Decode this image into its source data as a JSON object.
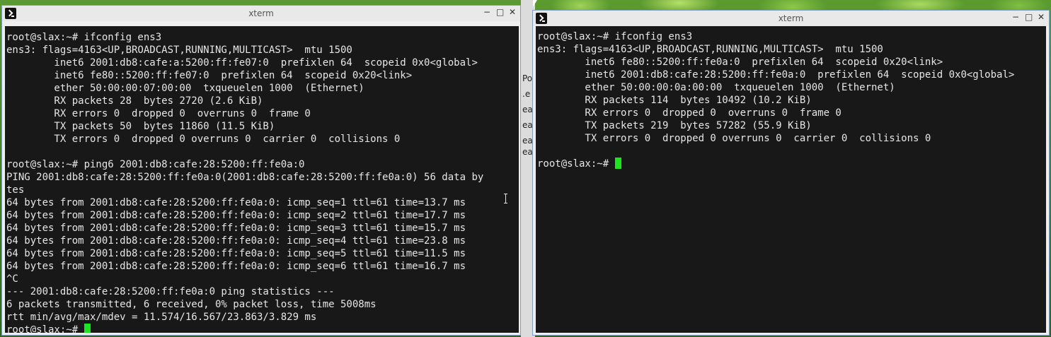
{
  "left_window": {
    "title": "xterm",
    "buttons": {
      "minimize": "−",
      "maximize": "□",
      "close": "✕"
    },
    "lines": [
      "root@slax:~# ifconfig ens3",
      "ens3: flags=4163<UP,BROADCAST,RUNNING,MULTICAST>  mtu 1500",
      "        inet6 2001:db8:cafe:a:5200:ff:fe07:0  prefixlen 64  scopeid 0x0<global>",
      "        inet6 fe80::5200:ff:fe07:0  prefixlen 64  scopeid 0x20<link>",
      "        ether 50:00:00:07:00:00  txqueuelen 1000  (Ethernet)",
      "        RX packets 28  bytes 2720 (2.6 KiB)",
      "        RX errors 0  dropped 0  overruns 0  frame 0",
      "        TX packets 50  bytes 11860 (11.5 KiB)",
      "        TX errors 0  dropped 0 overruns 0  carrier 0  collisions 0",
      "",
      "root@slax:~# ping6 2001:db8:cafe:28:5200:ff:fe0a:0",
      "PING 2001:db8:cafe:28:5200:ff:fe0a:0(2001:db8:cafe:28:5200:ff:fe0a:0) 56 data by",
      "tes",
      "64 bytes from 2001:db8:cafe:28:5200:ff:fe0a:0: icmp_seq=1 ttl=61 time=13.7 ms",
      "64 bytes from 2001:db8:cafe:28:5200:ff:fe0a:0: icmp_seq=2 ttl=61 time=17.7 ms",
      "64 bytes from 2001:db8:cafe:28:5200:ff:fe0a:0: icmp_seq=3 ttl=61 time=15.7 ms",
      "64 bytes from 2001:db8:cafe:28:5200:ff:fe0a:0: icmp_seq=4 ttl=61 time=23.8 ms",
      "64 bytes from 2001:db8:cafe:28:5200:ff:fe0a:0: icmp_seq=5 ttl=61 time=11.5 ms",
      "64 bytes from 2001:db8:cafe:28:5200:ff:fe0a:0: icmp_seq=6 ttl=61 time=16.7 ms",
      "^C",
      "--- 2001:db8:cafe:28:5200:ff:fe0a:0 ping statistics ---",
      "6 packets transmitted, 6 received, 0% packet loss, time 5008ms",
      "rtt min/avg/max/mdev = 11.574/16.567/23.863/3.829 ms"
    ],
    "prompt": "root@slax:~# "
  },
  "right_window": {
    "title": "xterm",
    "buttons": {
      "minimize": "−",
      "maximize": "□",
      "close": "✕"
    },
    "lines": [
      "root@slax:~# ifconfig ens3",
      "ens3: flags=4163<UP,BROADCAST,RUNNING,MULTICAST>  mtu 1500",
      "        inet6 fe80::5200:ff:fe0a:0  prefixlen 64  scopeid 0x20<link>",
      "        inet6 2001:db8:cafe:28:5200:ff:fe0a:0  prefixlen 64  scopeid 0x0<global>",
      "        ether 50:00:00:0a:00:00  txqueuelen 1000  (Ethernet)",
      "        RX packets 114  bytes 10492 (10.2 KiB)",
      "        RX errors 0  dropped 0  overruns 0  frame 0",
      "        TX packets 219  bytes 57282 (55.9 KiB)",
      "        TX errors 0  dropped 0 overruns 0  carrier 0  collisions 0",
      ""
    ],
    "prompt": "root@slax:~# "
  },
  "background_window_fragments": [
    "Po",
    ".e",
    "ea",
    "ea",
    "ea",
    "ea"
  ],
  "colors": {
    "terminal_bg": "#181818",
    "terminal_fg": "#e6e6e6",
    "cursor": "#1be51b"
  }
}
